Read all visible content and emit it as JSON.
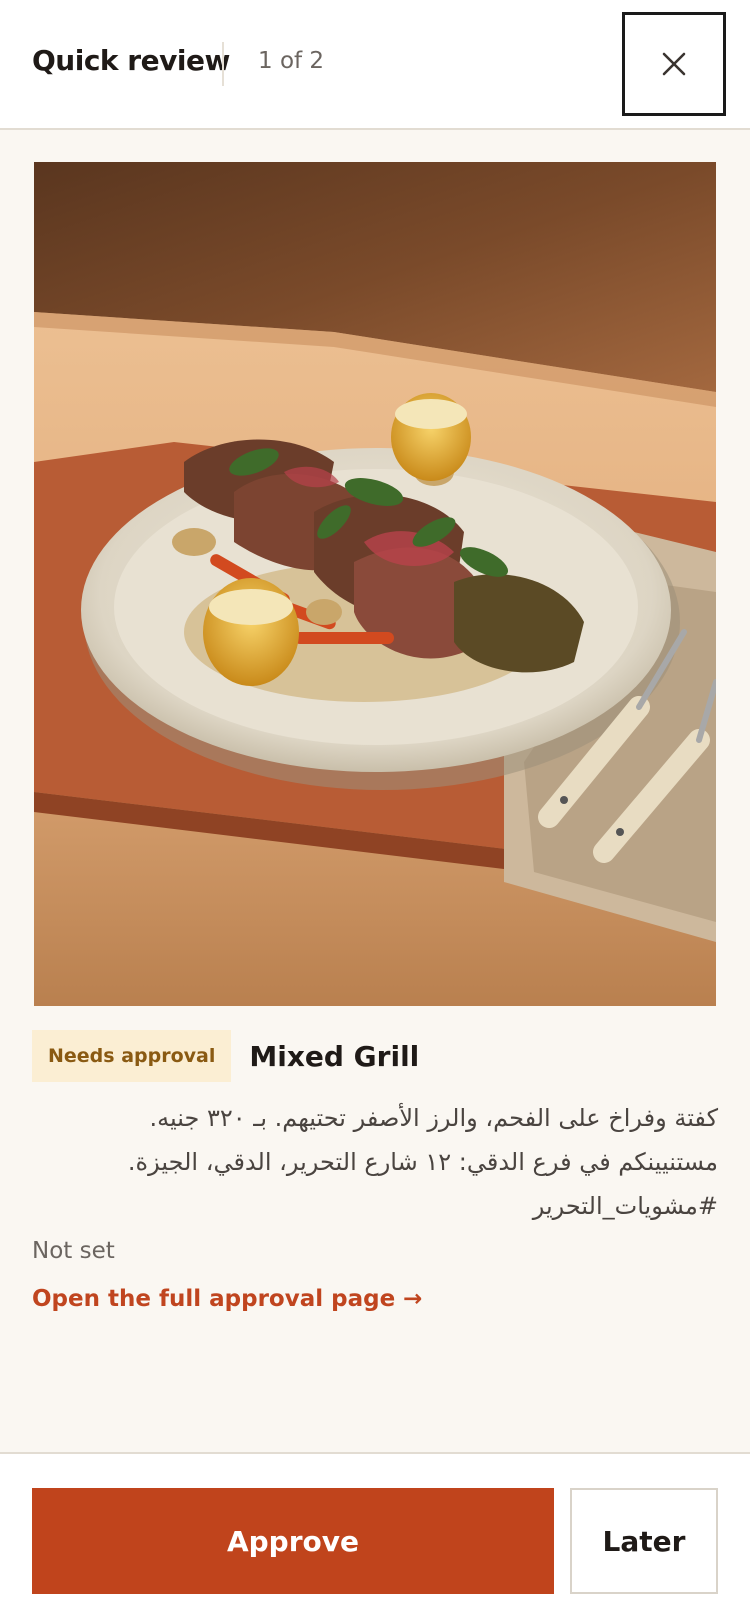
{
  "header": {
    "title": "Quick review",
    "counter": "1 of 2",
    "close_icon": "close-icon"
  },
  "post": {
    "image_alt": "Mixed grill plate with sliced steak, basil, grilled corn and vegetables",
    "status_badge": "Needs approval",
    "title": "Mixed Grill",
    "description": "كفتة وفراخ على الفحم، والرز الأصفر تحتيهم. بـ ٣٢٠ جنيه.\nمستنيينكم في فرع الدقي: ١٢ شارع التحرير، الدقي، الجيزة.\n#مشويات_التحرير",
    "schedule": "Not set",
    "full_page_link": "Open the full approval page →"
  },
  "actions": {
    "approve_label": "Approve",
    "later_label": "Later"
  },
  "colors": {
    "accent": "#c0441c",
    "badge_bg": "#fbeed3",
    "badge_text": "#8a5a12",
    "page_bg": "#faf7f2"
  }
}
